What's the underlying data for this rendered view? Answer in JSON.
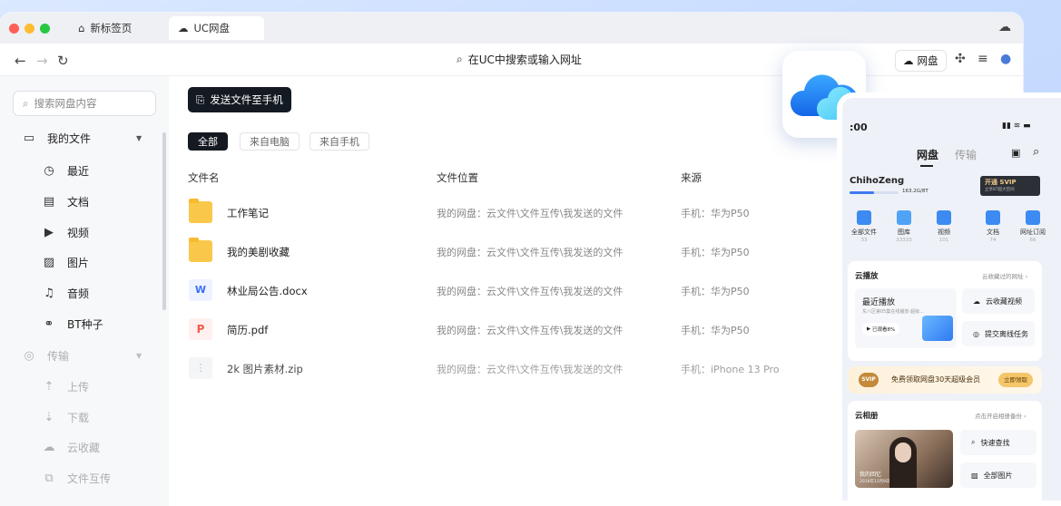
{
  "browser": {
    "tabs": [
      {
        "label": "新标签页",
        "icon": "home-icon"
      },
      {
        "label": "UC网盘",
        "icon": "cloud-icon"
      }
    ],
    "address_placeholder": "在UC中搜索或输入网址",
    "cloud_button_label": "网盘"
  },
  "sidebar": {
    "search_placeholder": "搜索网盘内容",
    "my_files_label": "我的文件",
    "file_items": [
      {
        "label": "最近",
        "icon": "clock-icon"
      },
      {
        "label": "文档",
        "icon": "document-icon"
      },
      {
        "label": "视频",
        "icon": "video-icon"
      },
      {
        "label": "图片",
        "icon": "image-icon"
      },
      {
        "label": "音频",
        "icon": "headphones-icon"
      },
      {
        "label": "BT种子",
        "icon": "link-icon"
      }
    ],
    "transfer_label": "传输",
    "transfer_items": [
      {
        "label": "上传",
        "icon": "upload-icon"
      },
      {
        "label": "下载",
        "icon": "download-icon"
      },
      {
        "label": "云收藏",
        "icon": "cloud-bookmark-icon"
      },
      {
        "label": "文件互传",
        "icon": "transfer-icon"
      }
    ]
  },
  "main": {
    "send_button_label": "发送文件至手机",
    "filters": [
      "全部",
      "来自电脑",
      "来自手机"
    ],
    "columns": {
      "name": "文件名",
      "location": "文件位置",
      "source": "来源"
    },
    "files": [
      {
        "name": "工作笔记",
        "type": "folder",
        "location": "我的网盘：云文件\\文件互传\\我发送的文件",
        "source": "手机：华为P50"
      },
      {
        "name": "我的美剧收藏",
        "type": "folder",
        "location": "我的网盘：云文件\\文件互传\\我发送的文件",
        "source": "手机：华为P50"
      },
      {
        "name": "林业局公告.docx",
        "type": "word",
        "location": "我的网盘：云文件\\文件互传\\我发送的文件",
        "source": "手机：华为P50"
      },
      {
        "name": "简历.pdf",
        "type": "pdf",
        "location": "我的网盘：云文件\\文件互传\\我发送的文件",
        "source": "手机：华为P50"
      },
      {
        "name": "2k 图片素材.zip",
        "type": "zip",
        "location": "我的网盘：云文件\\文件互传\\我发送的文件",
        "source": "手机：iPhone 13 Pro"
      }
    ]
  },
  "phone": {
    "time": ":00",
    "tabs": [
      "网盘",
      "传输"
    ],
    "user": "ChihoZeng",
    "storage": "163.2G/8T",
    "svip_title": "开通 SVIP",
    "svip_sub": "立享8T超大空间",
    "categories": [
      {
        "label": "全部文件",
        "count": "33",
        "color": "#3d8bf2"
      },
      {
        "label": "图库",
        "count": "33333",
        "color": "#4fa3f7"
      },
      {
        "label": "视频",
        "count": "101",
        "color": "#3d8bf2"
      },
      {
        "label": "文档",
        "count": "74",
        "color": "#3d8bf2"
      },
      {
        "label": "网址订阅",
        "count": "66",
        "color": "#3d8bf2"
      }
    ],
    "cloud_play": {
      "title": "云播放",
      "link": "云收藏过的网址",
      "recent_title": "最近播放",
      "recent_sub": "东八区第05集在线播放-超级...",
      "progress": "已观看8%",
      "actions": [
        "云收藏视频",
        "提交离线任务"
      ]
    },
    "promo": {
      "text": "免费领取网盘30天超级会员",
      "button": "立即领取",
      "badge": "SVIP"
    },
    "album": {
      "title": "云相册",
      "link": "点击开启相册备份",
      "memory": "我的回忆",
      "date": "2018年12月9日",
      "actions": [
        "快速查找",
        "全部图片"
      ]
    }
  }
}
